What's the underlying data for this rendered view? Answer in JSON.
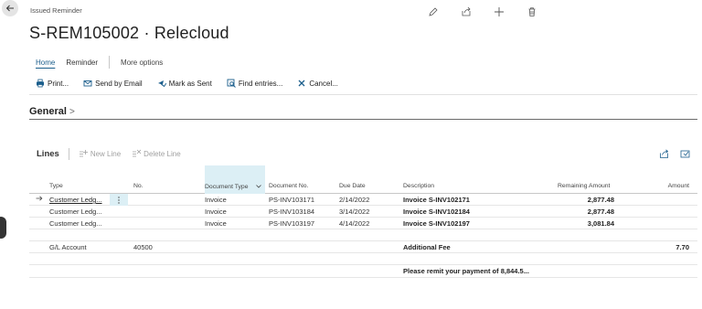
{
  "header": {
    "page_kind": "Issued Reminder",
    "title": "S-REM105002 · Relecloud"
  },
  "header_actions": [
    "edit-icon",
    "share-icon",
    "add-icon",
    "delete-icon"
  ],
  "tabs": [
    {
      "label": "Home",
      "active": true
    },
    {
      "label": "Reminder",
      "active": false
    },
    {
      "label": "More options",
      "active": false
    }
  ],
  "actions": [
    {
      "label": "Print...",
      "icon": "printer-icon"
    },
    {
      "label": "Send by Email",
      "icon": "email-icon"
    },
    {
      "label": "Mark as Sent",
      "icon": "mark-sent-icon"
    },
    {
      "label": "Find entries...",
      "icon": "find-entries-icon"
    },
    {
      "label": "Cancel...",
      "icon": "cancel-icon"
    }
  ],
  "section": {
    "title": "General",
    "chevron": ">"
  },
  "lines": {
    "title": "Lines",
    "new_line": "New Line",
    "delete_line": "Delete Line"
  },
  "columns": {
    "type": "Type",
    "no": "No.",
    "document_type": "Document Type",
    "document_no": "Document No.",
    "due_date": "Due Date",
    "description": "Description",
    "remaining_amount": "Remaining Amount",
    "amount": "Amount"
  },
  "rows": [
    {
      "type": "Customer Ledg...",
      "no": "",
      "document_type": "Invoice",
      "document_no": "PS-INV103171",
      "due_date": "2/14/2022",
      "description": "Invoice S-INV102171",
      "remaining_amount": "2,877.48",
      "amount": ""
    },
    {
      "type": "Customer Ledg...",
      "no": "",
      "document_type": "Invoice",
      "document_no": "PS-INV103184",
      "due_date": "3/14/2022",
      "description": "Invoice S-INV102184",
      "remaining_amount": "2,877.48",
      "amount": ""
    },
    {
      "type": "Customer Ledg...",
      "no": "",
      "document_type": "Invoice",
      "document_no": "PS-INV103197",
      "due_date": "4/14/2022",
      "description": "Invoice S-INV102197",
      "remaining_amount": "3,081.84",
      "amount": ""
    }
  ],
  "fee_row": {
    "type": "G/L Account",
    "no": "40500",
    "description": "Additional Fee",
    "amount": "7.70"
  },
  "remit_row": {
    "description": "Please remit your payment of 8,844.5..."
  }
}
